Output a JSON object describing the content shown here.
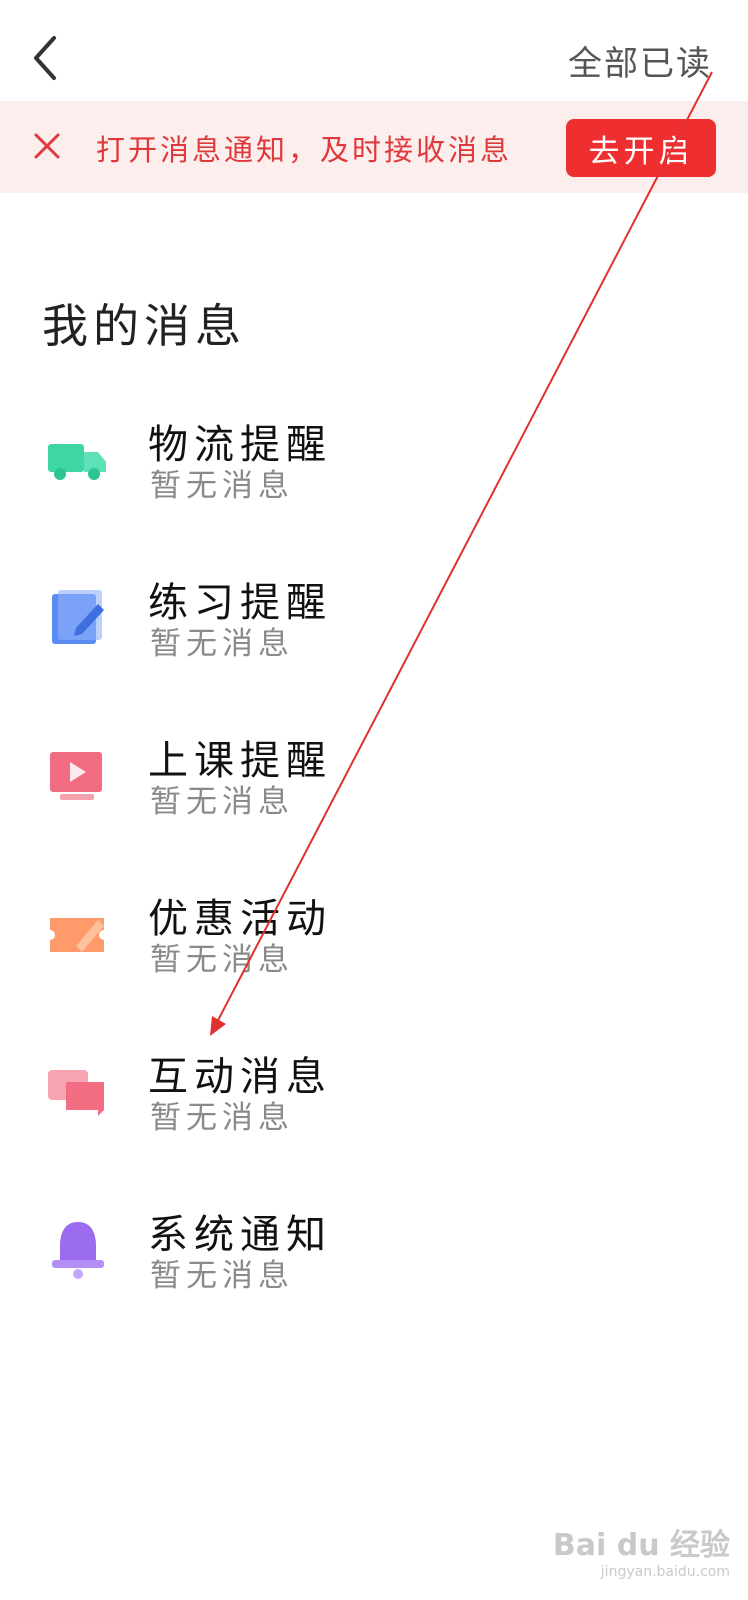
{
  "header": {
    "back_icon": "chevron-left-icon",
    "read_all_label": "全部已读"
  },
  "notify_bar": {
    "close_icon": "close-icon",
    "text": "打开消息通知，及时接收消息",
    "button_label": "去开启",
    "accent_color": "#ef2f2f",
    "background_color": "#fdeeee"
  },
  "section": {
    "title": "我的消息"
  },
  "messages": [
    {
      "title": "物流提醒",
      "subtitle": "暂无消息",
      "icon": "truck-icon",
      "color": "#3fd6a6"
    },
    {
      "title": "练习提醒",
      "subtitle": "暂无消息",
      "icon": "notebook-pencil-icon",
      "color": "#5b8cf4"
    },
    {
      "title": "上课提醒",
      "subtitle": "暂无消息",
      "icon": "play-screen-icon",
      "color": "#f36d82"
    },
    {
      "title": "优惠活动",
      "subtitle": "暂无消息",
      "icon": "ticket-icon",
      "color": "#ff9a6b"
    },
    {
      "title": "互动消息",
      "subtitle": "暂无消息",
      "icon": "chat-bubbles-icon",
      "color": "#f36d82"
    },
    {
      "title": "系统通知",
      "subtitle": "暂无消息",
      "icon": "bell-icon",
      "color": "#9b6cf0"
    }
  ],
  "annotation": {
    "arrow_color": "#e03030"
  },
  "watermark": {
    "main": "Bai du 经验",
    "sub": "jingyan.baidu.com"
  }
}
